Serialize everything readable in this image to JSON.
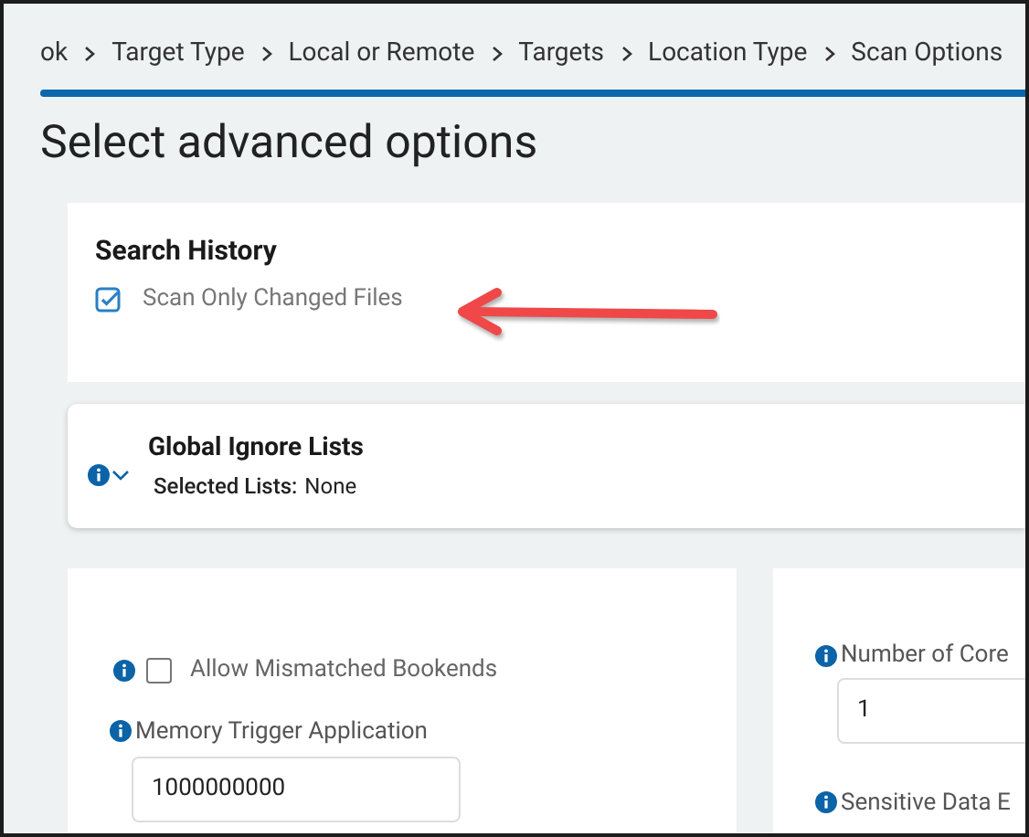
{
  "breadcrumb": [
    "ok",
    "Target Type",
    "Local or Remote",
    "Targets",
    "Location Type",
    "Scan Options"
  ],
  "heading": "Select advanced options",
  "search_history": {
    "title": "Search History",
    "option": {
      "label": "Scan Only Changed Files",
      "checked": true
    }
  },
  "global_ignore_lists": {
    "title": "Global Ignore Lists",
    "expanded": false,
    "selected_label": "Selected Lists:",
    "selected_value": "None"
  },
  "left_panel": {
    "option": {
      "label": "Allow Mismatched Bookends",
      "checked": false
    },
    "field": {
      "label": "Memory Trigger Application",
      "value": "1000000000"
    }
  },
  "right_panel": {
    "field": {
      "label": "Number of Core",
      "value": "1"
    },
    "field_2": {
      "label": "Sensitive Data E"
    }
  }
}
